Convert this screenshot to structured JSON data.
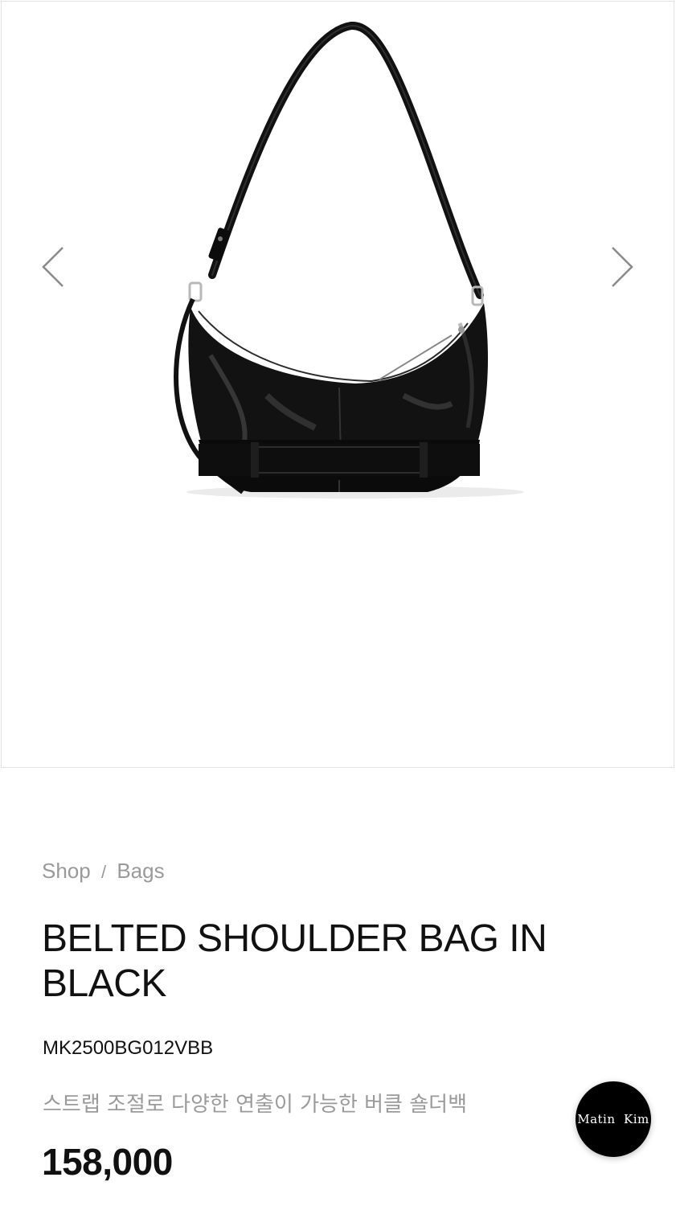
{
  "gallery": {
    "image_alt": "belted-shoulder-bag-black",
    "prev_icon": "chevron-left-icon",
    "next_icon": "chevron-right-icon",
    "arrow_color": "#8a8a8a"
  },
  "breadcrumb": {
    "items": [
      "Shop",
      "Bags"
    ],
    "separator": "/"
  },
  "product": {
    "title": "BELTED SHOULDER BAG IN BLACK",
    "sku": "MK2500BG012VBB",
    "subtitle": "스트랩 조절로 다양한 연출이 가능한 버클 숄더백",
    "price": "158,000"
  },
  "chat_button": {
    "label": "Matin  Kim",
    "color": "#000000"
  }
}
